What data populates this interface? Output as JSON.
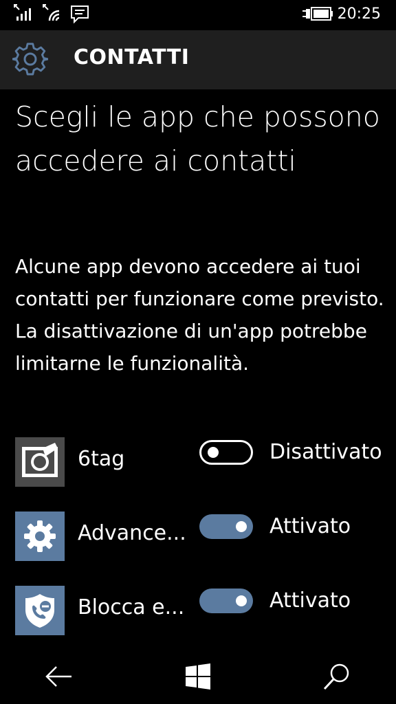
{
  "status": {
    "time": "20:25"
  },
  "header": {
    "title": "CONTATTI"
  },
  "page": {
    "title": "Scegli le app che possono accedere ai contatti",
    "description": "Alcune app devono accedere ai tuoi contatti per funzionare come previsto. La disattivazione di un'app potrebbe limitarne le funzionalità."
  },
  "apps": [
    {
      "name": "6tag",
      "state": "Disattivato",
      "enabled": false,
      "icon": "camera-icon"
    },
    {
      "name": "Advance...",
      "state": "Attivato",
      "enabled": true,
      "icon": "gear-icon"
    },
    {
      "name": "Blocca e...",
      "state": "Attivato",
      "enabled": true,
      "icon": "call-block-shield-icon"
    }
  ],
  "colors": {
    "accent": "#5b7ba0",
    "header_bg": "#1f1f1f"
  }
}
